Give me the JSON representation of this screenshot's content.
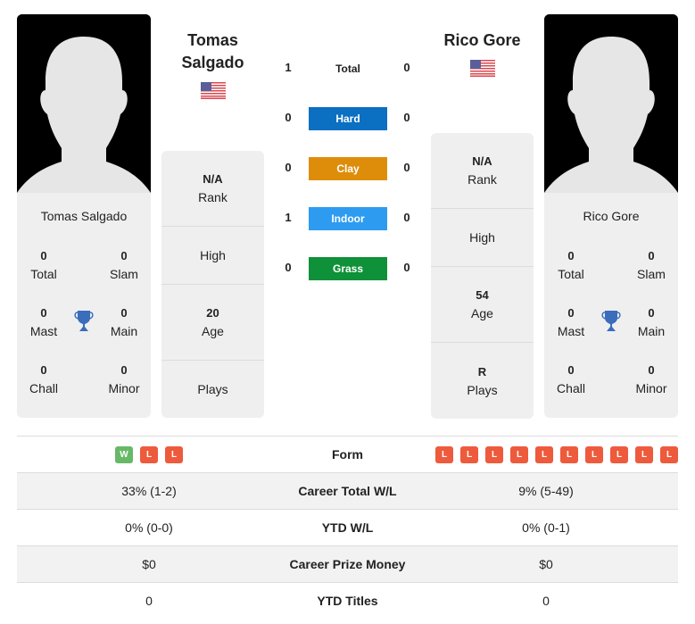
{
  "player1": {
    "name": "Tomas Salgado",
    "name_line1": "Tomas",
    "name_line2": "Salgado",
    "flag": "us-flag-icon",
    "titles": {
      "total": "0",
      "slam": "0",
      "mast": "0",
      "main": "0",
      "chall": "0",
      "minor": "0"
    },
    "rank": "N/A",
    "high": "",
    "age": "20",
    "plays": "",
    "form": [
      "W",
      "L",
      "L"
    ],
    "career_wl": "33% (1-2)",
    "ytd_wl": "0% (0-0)",
    "prize_money": "$0",
    "ytd_titles": "0"
  },
  "player2": {
    "name": "Rico Gore",
    "flag": "us-flag-icon",
    "titles": {
      "total": "0",
      "slam": "0",
      "mast": "0",
      "main": "0",
      "chall": "0",
      "minor": "0"
    },
    "rank": "N/A",
    "high": "",
    "age": "54",
    "plays": "R",
    "form": [
      "L",
      "L",
      "L",
      "L",
      "L",
      "L",
      "L",
      "L",
      "L",
      "L"
    ],
    "career_wl": "9% (5-49)",
    "ytd_wl": "0% (0-1)",
    "prize_money": "$0",
    "ytd_titles": "0"
  },
  "labels": {
    "total": "Total",
    "slam": "Slam",
    "mast": "Mast",
    "main": "Main",
    "chall": "Chall",
    "minor": "Minor",
    "rank": "Rank",
    "high": "High",
    "age": "Age",
    "plays": "Plays",
    "form": "Form",
    "career_wl": "Career Total W/L",
    "ytd_wl": "YTD W/L",
    "prize_money": "Career Prize Money",
    "ytd_titles": "YTD Titles"
  },
  "h2h": {
    "total": {
      "label": "Total",
      "p1": "1",
      "p2": "0"
    },
    "surfaces": [
      {
        "label": "Hard",
        "p1": "0",
        "p2": "0",
        "color": "#0b6fc2"
      },
      {
        "label": "Clay",
        "p1": "0",
        "p2": "0",
        "color": "#de8d0b"
      },
      {
        "label": "Indoor",
        "p1": "1",
        "p2": "0",
        "color": "#2d9bf0"
      },
      {
        "label": "Grass",
        "p1": "0",
        "p2": "0",
        "color": "#0e9138"
      }
    ]
  }
}
